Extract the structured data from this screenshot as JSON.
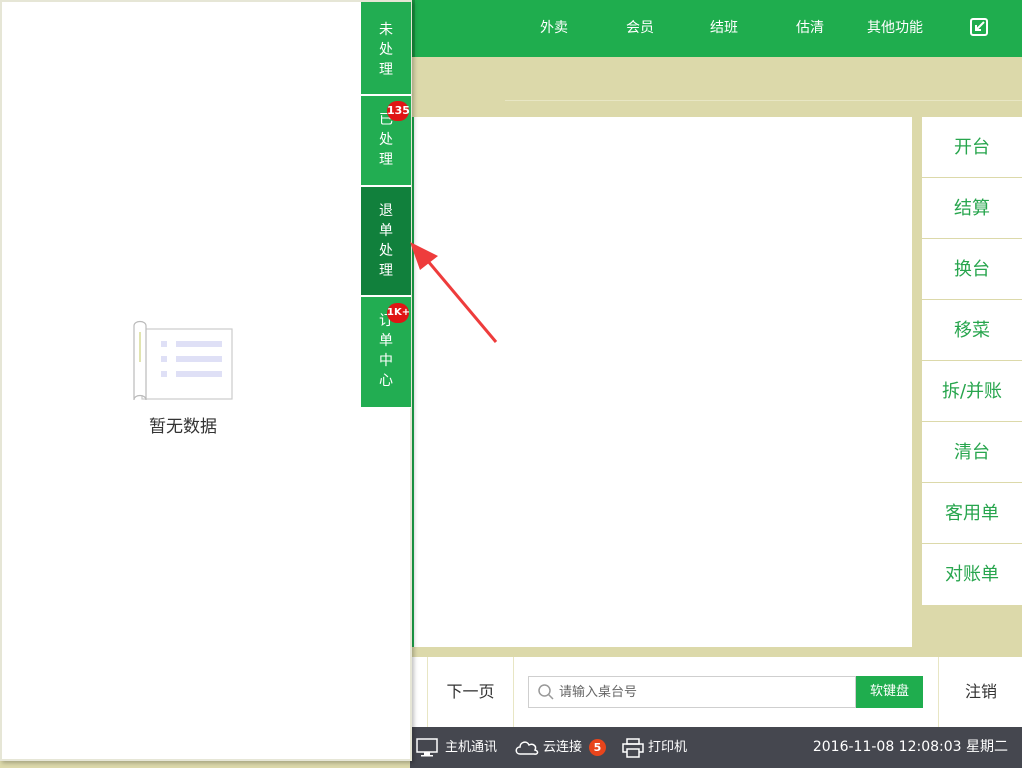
{
  "topnav": {
    "items": [
      "外卖",
      "会员",
      "结班",
      "估清",
      "其他功能"
    ],
    "exit_icon": "exit-icon"
  },
  "side_tabs": [
    {
      "label": "未处理",
      "badge": ""
    },
    {
      "label": "已处理",
      "badge": "135"
    },
    {
      "label": "退单处理",
      "badge": "",
      "active": true
    },
    {
      "label": "订单中心",
      "badge": "1K+"
    }
  ],
  "empty_state": {
    "text": "暂无数据",
    "icon": "empty-document-icon"
  },
  "actions": [
    "开台",
    "结算",
    "换台",
    "移菜",
    "拆/并账",
    "清台",
    "客用单",
    "对账单"
  ],
  "bottom": {
    "next_page": "下一页",
    "search_placeholder": "请输入桌台号",
    "keyboard": "软键盘",
    "logout": "注销"
  },
  "status": {
    "host": "主机通讯",
    "cloud": "云连接",
    "cloud_count": "5",
    "printer": "打印机",
    "datetime": "2016-11-08 12:08:03 星期二"
  },
  "colors": {
    "brand_green": "#1fad4e",
    "active_tab": "#11803c",
    "badge_red": "#e01515",
    "status_bg": "#45474f",
    "khaki_bg": "#dcd9aa"
  }
}
